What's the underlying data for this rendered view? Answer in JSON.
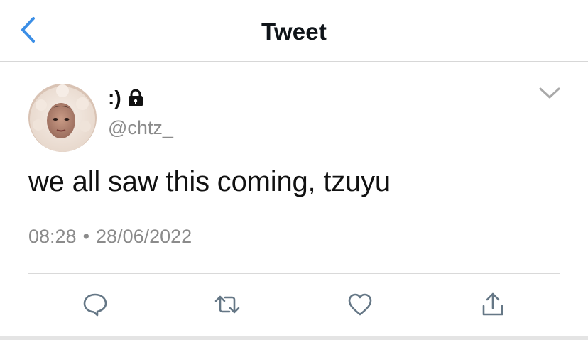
{
  "header": {
    "title": "Tweet",
    "back_icon": "chevron-left-icon",
    "accent_color": "#3b8ee6"
  },
  "tweet": {
    "author": {
      "display_name": ":)",
      "handle": "@chtz_",
      "protected_icon": "lock-icon",
      "avatar": "profile-photo"
    },
    "menu_icon": "chevron-down-icon",
    "text": "we all saw this coming, tzuyu",
    "time": "08:28",
    "separator": "•",
    "date": "28/06/2022",
    "actions": [
      {
        "name": "reply",
        "icon": "reply-icon"
      },
      {
        "name": "retweet",
        "icon": "retweet-icon"
      },
      {
        "name": "like",
        "icon": "heart-icon"
      },
      {
        "name": "share",
        "icon": "share-icon"
      }
    ],
    "colors": {
      "secondary_text": "#8b8b8b",
      "action_icon": "#657786"
    }
  }
}
